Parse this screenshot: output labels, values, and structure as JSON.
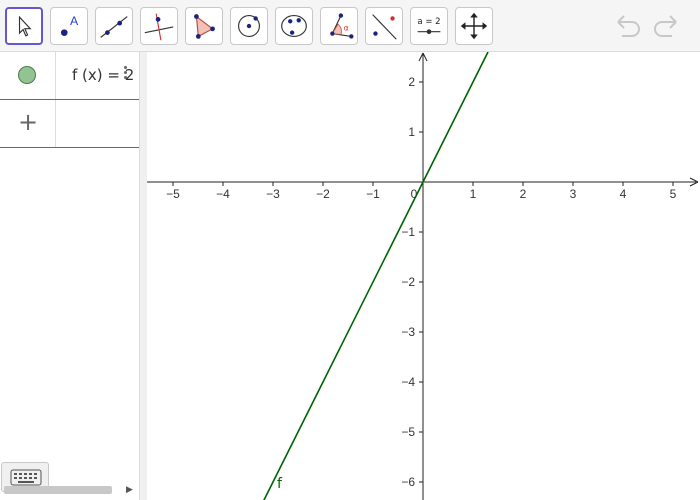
{
  "toolbar": {
    "tools": [
      {
        "name": "move-tool",
        "selected": true
      },
      {
        "name": "point-tool",
        "label": "A"
      },
      {
        "name": "line-tool"
      },
      {
        "name": "perpendicular-line-tool"
      },
      {
        "name": "polygon-tool"
      },
      {
        "name": "circle-tool"
      },
      {
        "name": "conic-tool"
      },
      {
        "name": "angle-tool",
        "label": "α"
      },
      {
        "name": "reflect-tool"
      },
      {
        "name": "slider-tool",
        "label": "a = 2"
      },
      {
        "name": "move-graphics-tool"
      }
    ],
    "undo_icon": "undo-icon",
    "redo_icon": "redo-icon"
  },
  "algebra": {
    "items": [
      {
        "formula": "f (x) = 2",
        "color": "#93c392"
      }
    ],
    "add_label": "+"
  },
  "graphics": {
    "axis_x_ticks": [
      "−5",
      "−4",
      "−3",
      "−2",
      "−1",
      "0",
      "1",
      "2",
      "3",
      "4",
      "5"
    ],
    "axis_y_ticks": [
      "2",
      "1",
      "−1",
      "−2",
      "−3",
      "−4",
      "−5",
      "−6"
    ],
    "function": {
      "name": "f",
      "slope": 2,
      "intercept": 0,
      "color": "#006400"
    },
    "x_range": [
      -5.5,
      5.5
    ],
    "y_range": [
      -6.3,
      2.6
    ]
  },
  "colors": {
    "accent": "#6557d2",
    "function": "#006400"
  }
}
